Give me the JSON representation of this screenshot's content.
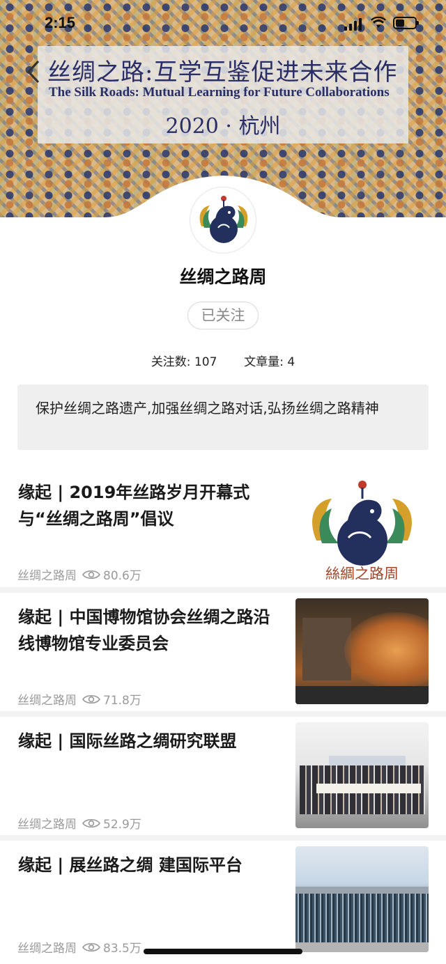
{
  "status_bar": {
    "time": "2:15"
  },
  "banner": {
    "title_cn": "丝绸之路:互学互鉴促进未来合作",
    "title_en": "The Silk Roads: Mutual Learning for Future Collaborations",
    "date_place": "2020 · 杭州"
  },
  "profile": {
    "name": "丝绸之路周",
    "follow_label": "已关注",
    "followers_label": "关注数:",
    "followers_count": "107",
    "articles_label": "文章量:",
    "articles_count": "4",
    "description": "保护丝绸之路遗产,加强丝绸之路对话,弘扬丝绸之路精神",
    "logo_text": "絲綢之路周"
  },
  "articles": [
    {
      "title": "缘起 | 2019年丝路岁月开幕式与“丝绸之路周”倡议",
      "source": "丝绸之路周",
      "views": "80.6万"
    },
    {
      "title": "缘起 | 中国博物馆协会丝绸之路沿线博物馆专业委员会",
      "source": "丝绸之路周",
      "views": "71.8万"
    },
    {
      "title": "缘起 | 国际丝路之绸研究联盟",
      "source": "丝绸之路周",
      "views": "52.9万"
    },
    {
      "title": "缘起 | 展丝路之绸 建国际平台",
      "source": "丝绸之路周",
      "views": "83.5万"
    }
  ],
  "colors": {
    "accent_navy": "#2a2e66",
    "logo_gold": "#d4a02a",
    "logo_green": "#3b8a5a",
    "meta_gray": "#9a9a9a"
  }
}
